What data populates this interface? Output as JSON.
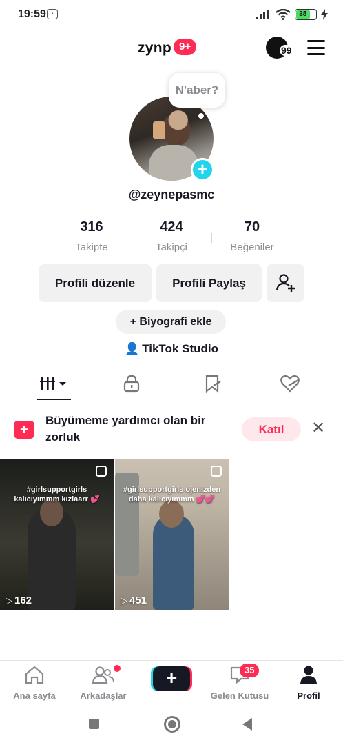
{
  "status_bar": {
    "time": "19:59",
    "battery": "38"
  },
  "header": {
    "title": "zynp",
    "notification_badge": "9+",
    "coins": "99"
  },
  "profile": {
    "bubble_text": "N'aber?",
    "handle": "@zeynepasmc",
    "stats": [
      {
        "value": "316",
        "label": "Takipte"
      },
      {
        "value": "424",
        "label": "Takipçi"
      },
      {
        "value": "70",
        "label": "Beğeniler"
      }
    ],
    "edit_button": "Profili düzenle",
    "share_button": "Profili Paylaş",
    "bio_button": "+ Biyografi ekle",
    "studio_link": "TikTok Studio"
  },
  "tabs": [
    {
      "icon": "videos-grid-icon"
    },
    {
      "icon": "lock-icon"
    },
    {
      "icon": "bookmark-icon"
    },
    {
      "icon": "liked-heart-icon"
    }
  ],
  "challenge": {
    "text": "Büyümeme yardımcı olan bir zorluk",
    "join_button": "Katıl"
  },
  "videos": [
    {
      "caption": "#girlsupportgirls kalıcıyımmm kızlaarr 💕",
      "views": "162"
    },
    {
      "caption": "#girlsupportgirls ojenizden daha kalıcıyımmm 💕💕",
      "views": "451"
    }
  ],
  "bottom_nav": {
    "home": "Ana sayfa",
    "friends": "Arkadaşlar",
    "create": "+",
    "inbox": "Gelen Kutusu",
    "inbox_badge": "35",
    "profile": "Profil"
  },
  "colors": {
    "accent": "#fe2c55",
    "cyan": "#20d5ec",
    "text": "#161823",
    "muted": "#8a8b91"
  }
}
